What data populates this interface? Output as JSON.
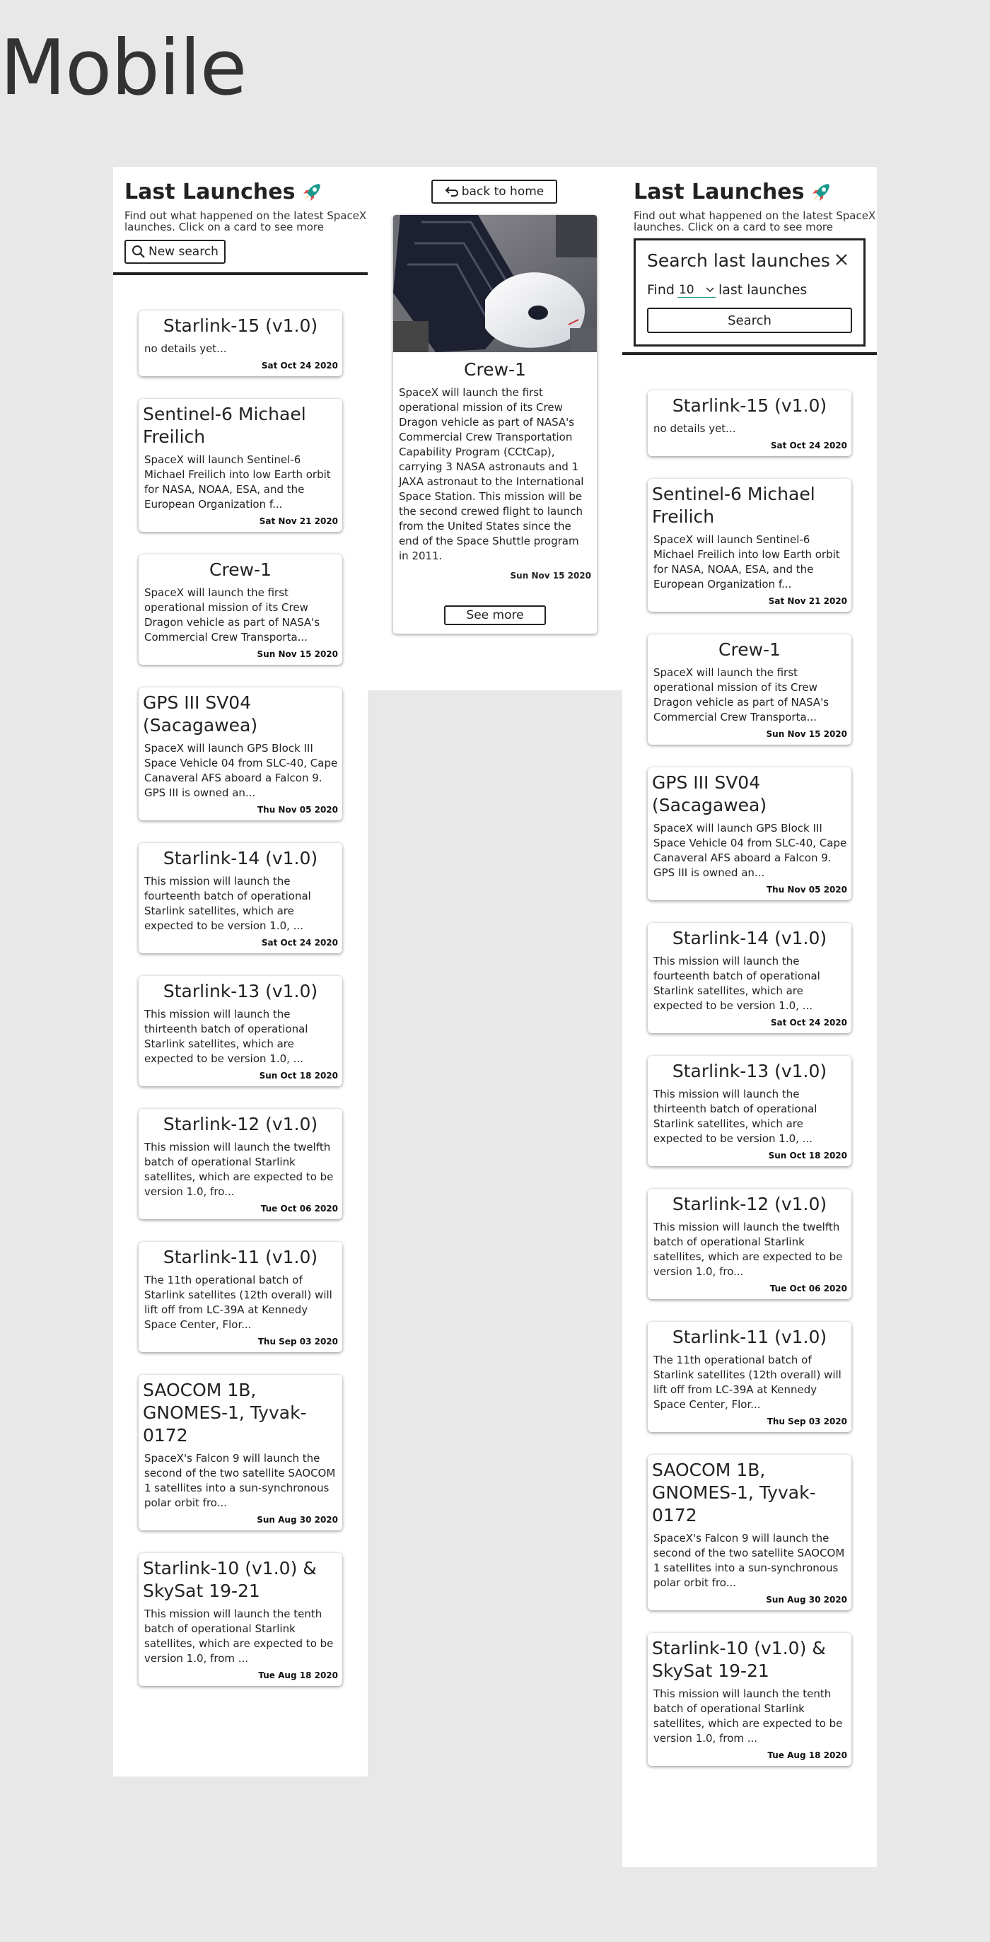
{
  "page": {
    "title": "Mobile"
  },
  "list_header": {
    "title": "Last Launches",
    "subtitle": "Find out what happened on the latest SpaceX launches. Click on a card to see more",
    "new_search_label": "New search"
  },
  "launches": [
    {
      "name": "Starlink-15 (v1.0)",
      "details": "no details yet...",
      "date": "Sat Oct 24 2020"
    },
    {
      "name": "Sentinel-6 Michael Freilich",
      "details": "SpaceX will launch Sentinel-6 Michael Freilich into low Earth orbit for NASA, NOAA, ESA, and the European Organization f...",
      "date": "Sat Nov 21 2020"
    },
    {
      "name": "Crew-1",
      "details": "SpaceX will launch the first operational mission of its Crew Dragon vehicle as part of NASA's Commercial Crew Transporta...",
      "date": "Sun Nov 15 2020"
    },
    {
      "name": "GPS III SV04 (Sacagawea)",
      "details": "SpaceX will launch GPS Block III Space Vehicle 04 from SLC-40, Cape Canaveral AFS aboard a Falcon 9. GPS III is owned an...",
      "date": "Thu Nov 05 2020"
    },
    {
      "name": "Starlink-14 (v1.0)",
      "details": "This mission will launch the fourteenth batch of operational Starlink satellites, which are expected to be version 1.0, ...",
      "date": "Sat Oct 24 2020"
    },
    {
      "name": "Starlink-13 (v1.0)",
      "details": "This mission will launch the thirteenth batch of operational Starlink satellites, which are expected to be version 1.0, ...",
      "date": "Sun Oct 18 2020"
    },
    {
      "name": "Starlink-12 (v1.0)",
      "details": "This mission will launch the twelfth batch of operational Starlink satellites, which are expected to be version 1.0, fro...",
      "date": "Tue Oct 06 2020"
    },
    {
      "name": "Starlink-11 (v1.0)",
      "details": "The 11th operational batch of Starlink satellites (12th overall) will lift off from LC-39A at Kennedy Space Center, Flor...",
      "date": "Thu Sep 03 2020"
    },
    {
      "name": "SAOCOM 1B, GNOMES-1, Tyvak-0172",
      "details": "SpaceX's Falcon 9 will launch the second of the two satellite SAOCOM 1 satellites into a sun-synchronous polar orbit fro...",
      "date": "Sun Aug 30 2020"
    },
    {
      "name": "Starlink-10 (v1.0) & SkySat 19-21",
      "details": "This mission will launch the tenth batch of operational Starlink satellites, which are expected to be version 1.0, from ...",
      "date": "Tue Aug 18 2020"
    }
  ],
  "detail": {
    "back_label": "back to home",
    "name": "Crew-1",
    "details": "SpaceX will launch the first operational mission of its Crew Dragon vehicle as part of NASA's Commercial Crew Transportation Capability Program (CCtCap), carrying 3 NASA astronauts and 1 JAXA astronaut to the International Space Station. This mission will be the second crewed flight to launch from the United States since the end of the Space Shuttle program in 2011.",
    "date": "Sun Nov 15 2020",
    "see_more_label": "See more"
  },
  "search_form": {
    "title": "Search last launches",
    "find_prefix": "Find",
    "count_value": "10",
    "find_suffix": "last launches",
    "search_label": "Search"
  },
  "colors": {
    "accent": "#1a9b8d",
    "background": "#e8e8e8",
    "panel": "#ffffff",
    "text": "#222222"
  }
}
